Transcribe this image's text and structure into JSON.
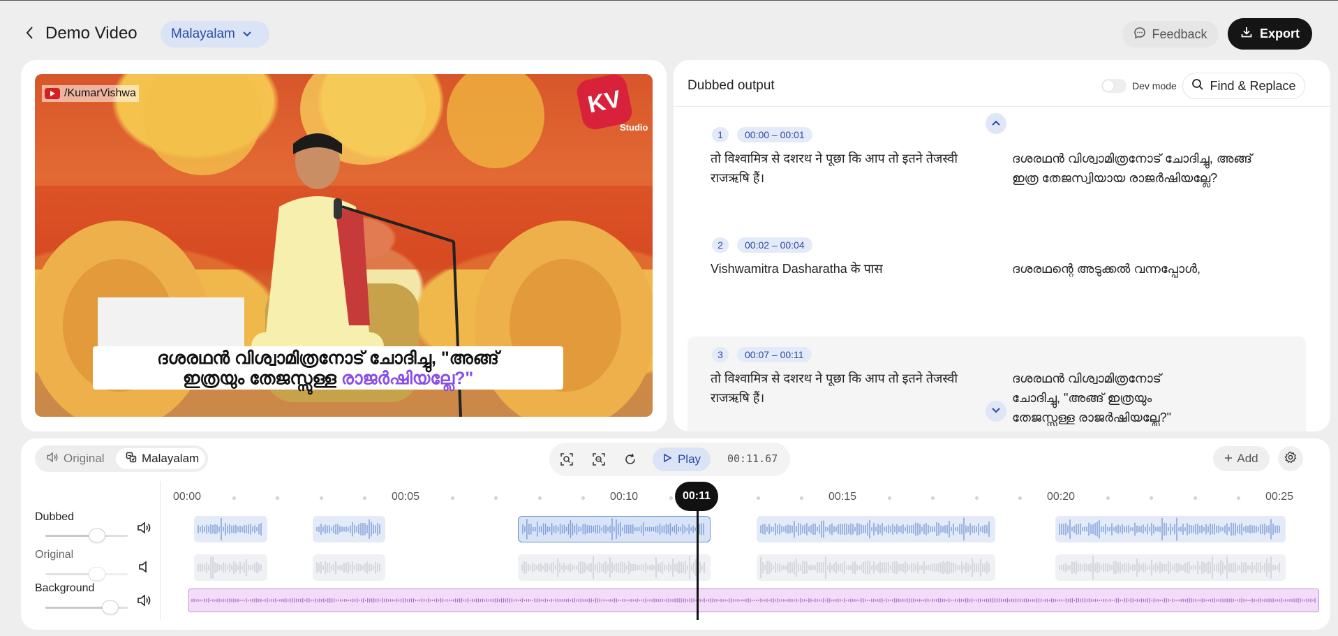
{
  "header": {
    "back_icon": "chevron-left-icon",
    "title": "Demo Video",
    "language": "Malayalam",
    "feedback_label": "Feedback",
    "export_label": "Export"
  },
  "video": {
    "channel_handle": "/KumarVishwa",
    "logo_text": "KV",
    "studio_text": "Studio",
    "subtitle_line1": "ദശരഥൻ വിശ്വാമിത്രനോട് ചോദിച്ചു, \"അങ്ങ്",
    "subtitle_line2_plain": "ഇത്രയും തേജസ്സുള്ള ",
    "subtitle_line2_highlight": "രാജർഷിയല്ലേ?\""
  },
  "dubbed": {
    "title": "Dubbed output",
    "dev_mode_label": "Dev mode",
    "dev_mode_on": false,
    "find_replace_label": "Find & Replace",
    "segments": [
      {
        "number": "1",
        "time": "00:00 – 00:01",
        "source": "तो विश्वामित्र से दशरथ ने पूछा कि आप तो इतने तेजस्वी राजऋषि हैं।",
        "dubbed": "ദശരഥൻ വിശ്വാമിത്രനോട് ചോദിച്ചു, അങ്ങ് ഇത്ര തേജസ്വിയായ രാജർഷിയല്ലേ?"
      },
      {
        "number": "2",
        "time": "00:02 – 00:04",
        "source": "Vishwamitra Dasharatha के पास",
        "dubbed": "ദശരഥന്റെ അടുക്കൽ വന്നപ്പോൾ,"
      },
      {
        "number": "3",
        "time": "00:07 – 00:11",
        "source": "तो विश्वामित्र से दशरथ ने पूछा कि आप तो इतने तेजस्वी राजऋषि हैं।",
        "dubbed": "ദശരഥൻ വിശ്വാമിത്രനോട് ചോദിച്ചു, \"അങ്ങ് ഇത്രയും തേജസ്സുള്ള രാജർഷിയല്ലേ?\""
      }
    ]
  },
  "timeline": {
    "track_original_label": "Original",
    "track_malayalam_label": "Malayalam",
    "play_label": "Play",
    "timecode": "00:11.67",
    "add_label": "Add",
    "playhead_label": "00:11",
    "ruler_labels": [
      "00:00",
      "00:05",
      "00:10",
      "00:15",
      "00:20",
      "00:25"
    ],
    "lanes": [
      {
        "name": "Dubbed",
        "volume": 0.62,
        "muted": false
      },
      {
        "name": "Original",
        "volume": 0.62,
        "muted": true
      },
      {
        "name": "Background",
        "volume": 0.78,
        "muted": false
      }
    ]
  },
  "colors": {
    "accent": "#2b4aa0",
    "accent_bg": "#dbe4f7",
    "subtitle_highlight": "#8a4ee8",
    "background_track": "#f2dcf7"
  }
}
